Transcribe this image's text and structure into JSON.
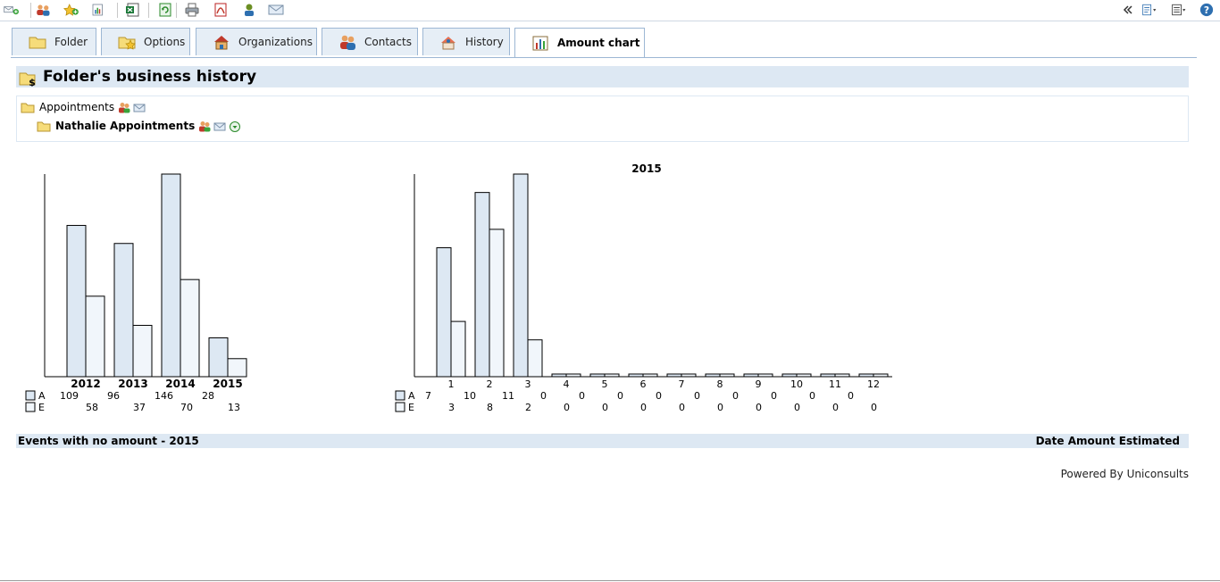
{
  "tabs": [
    {
      "label": "Folder",
      "icon": "folder-icon"
    },
    {
      "label": "Options",
      "icon": "options-icon"
    },
    {
      "label": "Organizations",
      "icon": "organization-icon"
    },
    {
      "label": "Contacts",
      "icon": "contacts-icon"
    },
    {
      "label": "History",
      "icon": "history-icon"
    },
    {
      "label": "Amount chart",
      "icon": "bar-chart-icon",
      "active": true
    }
  ],
  "page": {
    "title": "Folder's business history"
  },
  "folders": {
    "root": "Appointments",
    "child": "Nathalie Appointments"
  },
  "colors": {
    "actual": "#dde8f3",
    "estimated": "#f1f6fb",
    "band": "#dde8f3",
    "tab_border": "#9db7d4"
  },
  "chart_data": [
    {
      "type": "bar",
      "title": "",
      "categories": [
        "2012",
        "2013",
        "2014",
        "2015"
      ],
      "series": [
        {
          "name": "A",
          "values": [
            109,
            96,
            146,
            28
          ]
        },
        {
          "name": "E",
          "values": [
            58,
            37,
            70,
            13
          ]
        }
      ],
      "ylim": [
        0,
        146
      ],
      "legend": "bottom-left"
    },
    {
      "type": "bar",
      "title": "2015",
      "categories": [
        "1",
        "2",
        "3",
        "4",
        "5",
        "6",
        "7",
        "8",
        "9",
        "10",
        "11",
        "12"
      ],
      "series": [
        {
          "name": "A",
          "values": [
            7,
            10,
            11,
            0,
            0,
            0,
            0,
            0,
            0,
            0,
            0,
            0
          ]
        },
        {
          "name": "E",
          "values": [
            3,
            8,
            2,
            0,
            0,
            0,
            0,
            0,
            0,
            0,
            0,
            0
          ]
        }
      ],
      "ylim": [
        0,
        11
      ],
      "legend": "bottom-left"
    }
  ],
  "bottom": {
    "left": "Events with no amount - 2015",
    "right": "Date Amount Estimated"
  },
  "footer": {
    "powered": "Powered By Uniconsults"
  }
}
